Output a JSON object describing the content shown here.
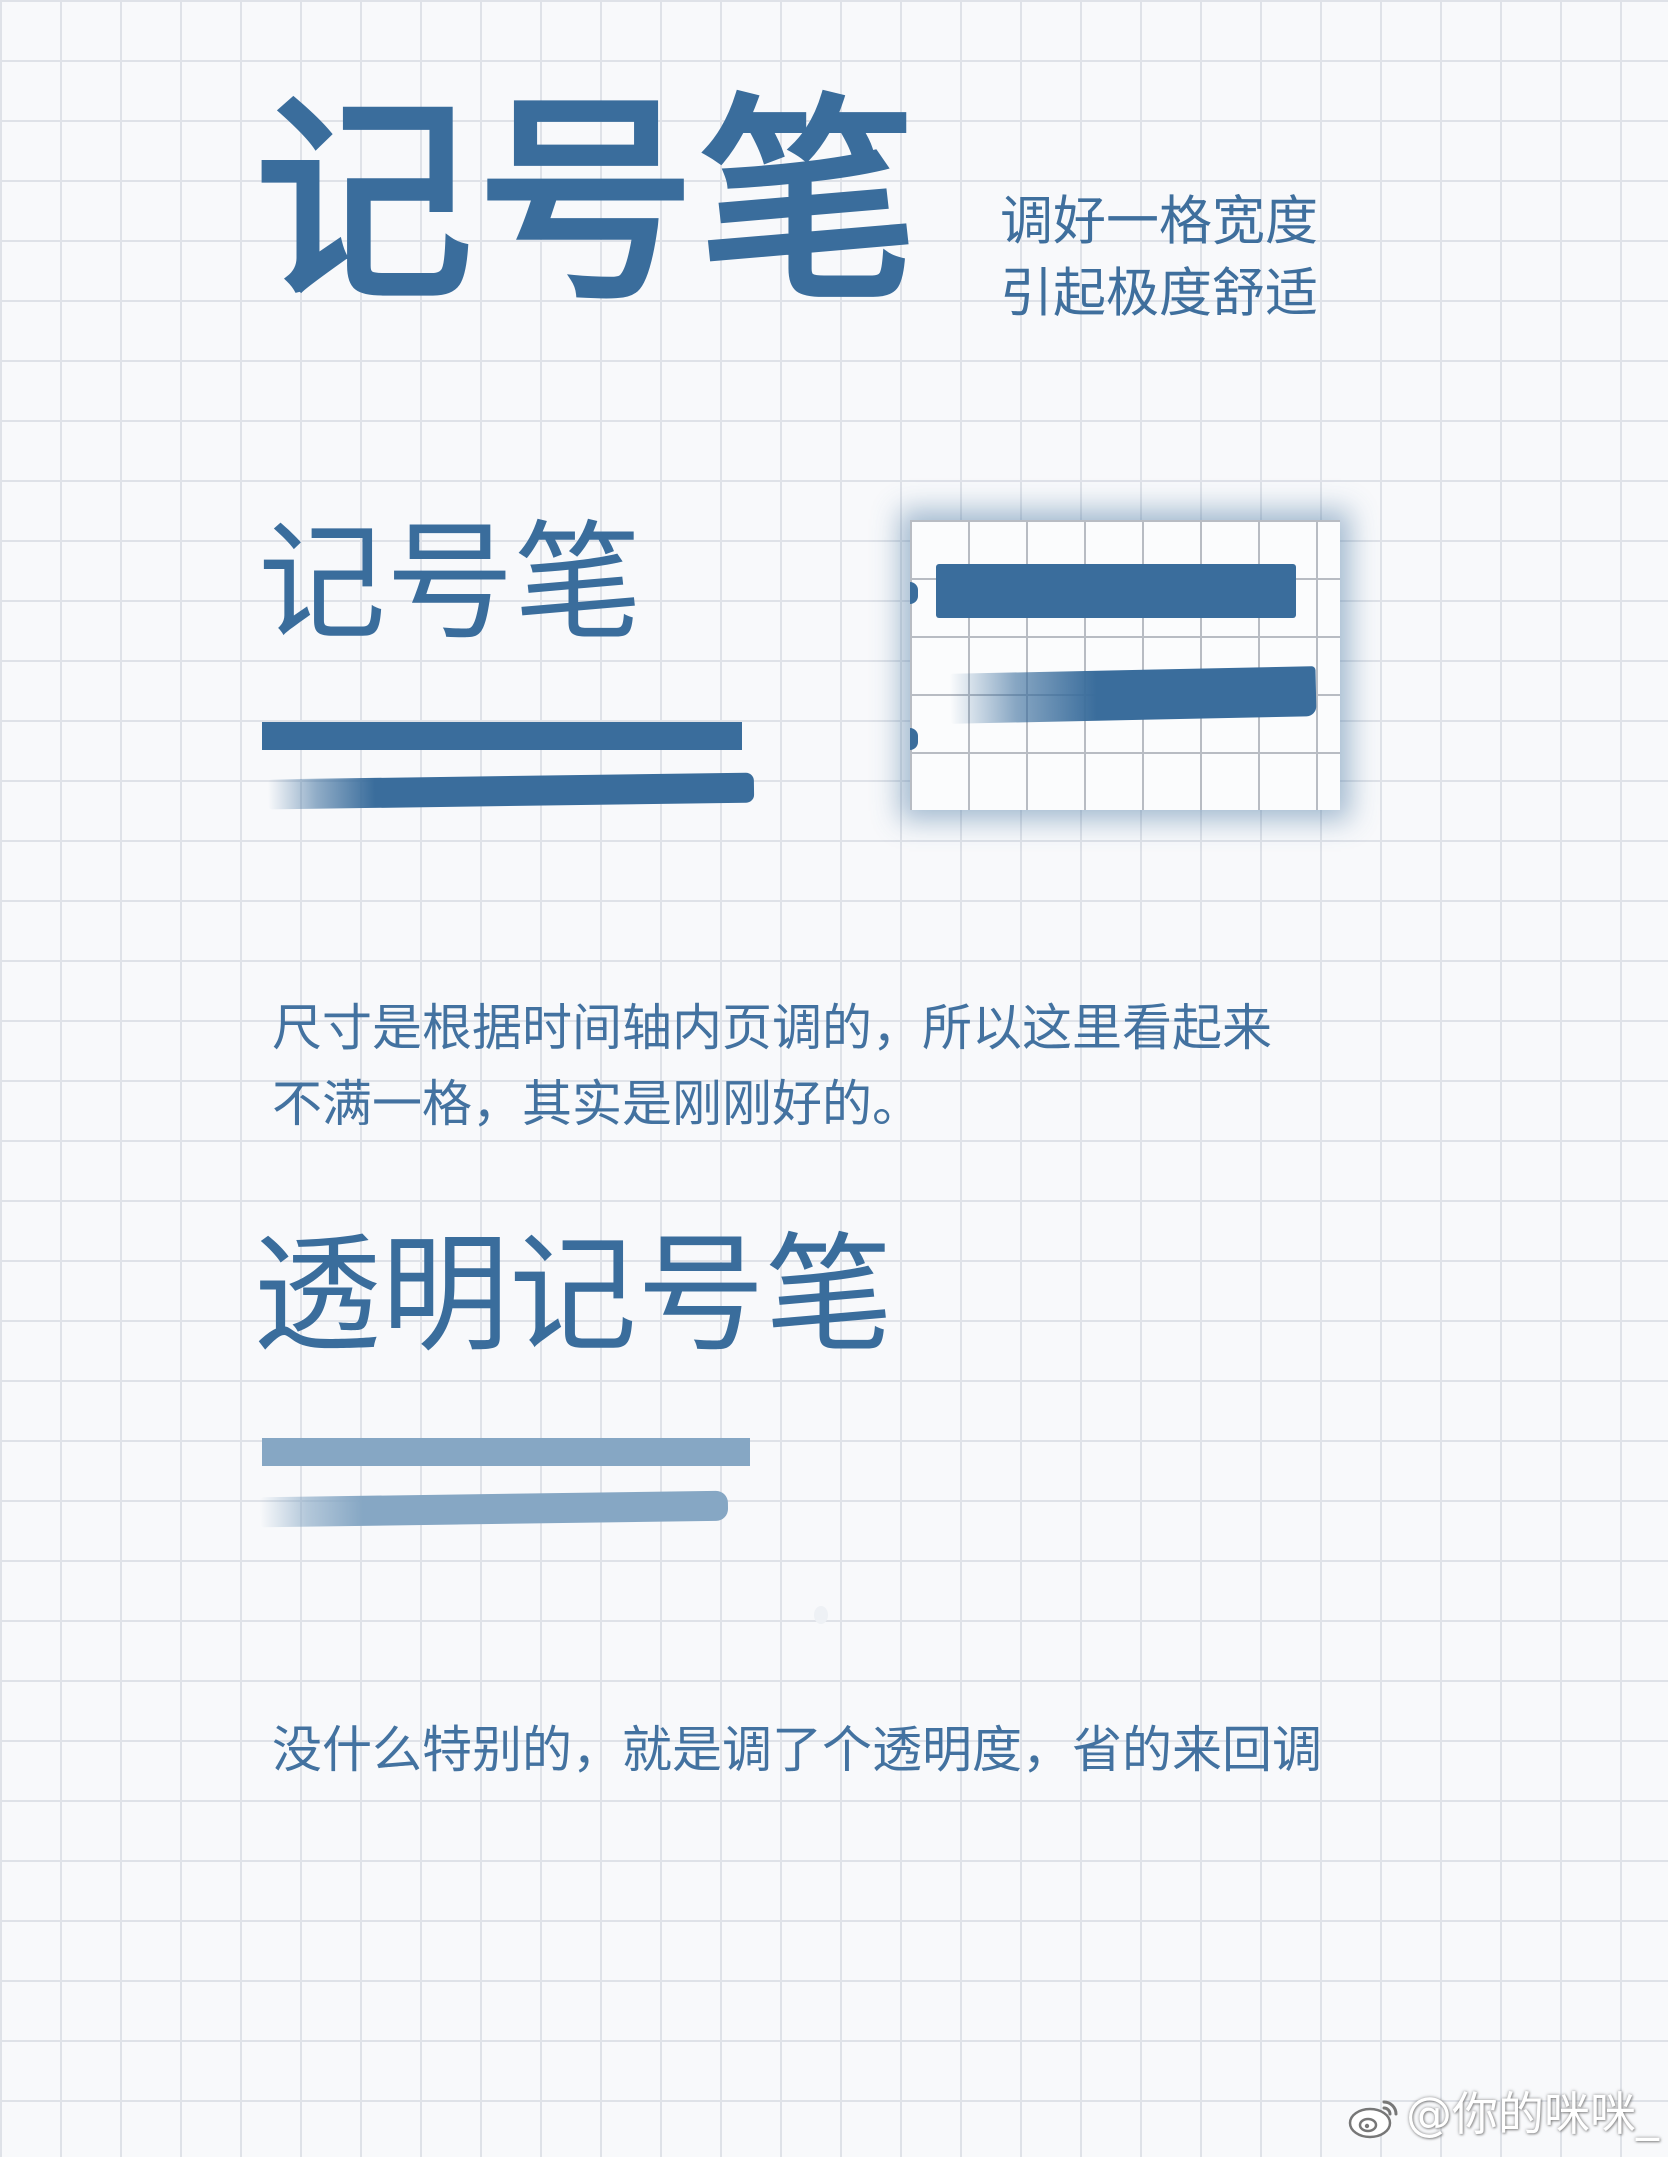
{
  "header": {
    "title": "记号笔",
    "subtitle_line1": "调好一格宽度",
    "subtitle_line2": "引起极度舒适"
  },
  "section_marker": {
    "title": "记号笔",
    "caption_line1": "尺寸是根据时间轴内页调的，所以这里看起来",
    "caption_line2": "不满一格，其实是刚刚好的。"
  },
  "section_transparent": {
    "title": "透明记号笔",
    "caption": "没什么特别的，就是调了个透明度，省的来回调"
  },
  "colors": {
    "ink": "#3a6d9c",
    "ink_transparent": "#86a7c4",
    "grid": "#dfe2e8",
    "paper": "#f8f9fb"
  },
  "watermark": {
    "icon": "weibo-icon",
    "text": "@你的咪咪_"
  }
}
